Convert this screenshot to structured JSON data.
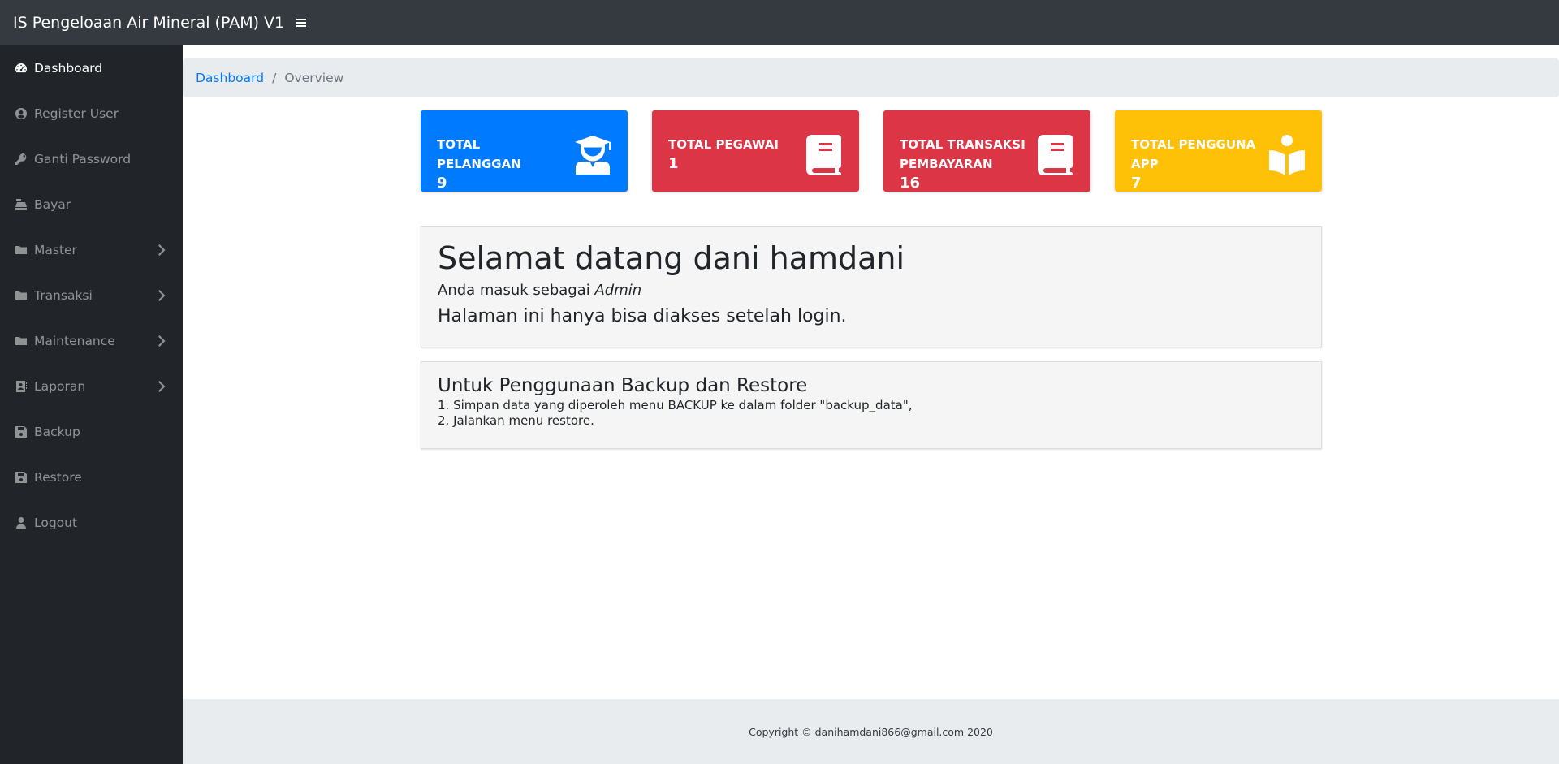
{
  "header": {
    "title": "IS Pengeloaan Air Mineral (PAM) V1",
    "menu_icon": "hamburger-icon"
  },
  "sidebar": {
    "items": [
      {
        "label": "Dashboard",
        "icon": "tachometer-icon",
        "active": true,
        "has_arrow": false
      },
      {
        "label": "Register User",
        "icon": "user-circle-icon",
        "active": false,
        "has_arrow": false
      },
      {
        "label": "Ganti Password",
        "icon": "key-icon",
        "active": false,
        "has_arrow": false
      },
      {
        "label": "Bayar",
        "icon": "cash-register-icon",
        "active": false,
        "has_arrow": false
      },
      {
        "label": "Master",
        "icon": "folder-icon",
        "active": false,
        "has_arrow": true
      },
      {
        "label": "Transaksi",
        "icon": "folder-icon",
        "active": false,
        "has_arrow": true
      },
      {
        "label": "Maintenance",
        "icon": "folder-icon",
        "active": false,
        "has_arrow": true
      },
      {
        "label": "Laporan",
        "icon": "address-book-icon",
        "active": false,
        "has_arrow": true
      },
      {
        "label": "Backup",
        "icon": "save-icon",
        "active": false,
        "has_arrow": false
      },
      {
        "label": "Restore",
        "icon": "save-icon",
        "active": false,
        "has_arrow": false
      },
      {
        "label": "Logout",
        "icon": "user-icon",
        "active": false,
        "has_arrow": false
      }
    ]
  },
  "breadcrumb": {
    "link": "Dashboard",
    "separator": "/",
    "current": "Overview"
  },
  "cards": [
    {
      "title": "TOTAL PELANGGAN",
      "value": "9",
      "icon": "user-graduate-icon",
      "color": "#007bff"
    },
    {
      "title": "TOTAL PEGAWAI",
      "value": "1",
      "icon": "book-icon",
      "color": "#dc3545"
    },
    {
      "title": "TOTAL TRANSAKSI PEMBAYARAN",
      "value": "16",
      "icon": "book-icon",
      "color": "#dc3545"
    },
    {
      "title": "TOTAL PENGGUNA APP",
      "value": "7",
      "icon": "book-reader-icon",
      "color": "#ffc107"
    }
  ],
  "welcome": {
    "heading": "Selamat datang dani hamdani",
    "role_prefix": "Anda masuk sebagai ",
    "role": "Admin",
    "note": "Halaman ini hanya bisa diakses setelah login."
  },
  "backup_info": {
    "heading": "Untuk Penggunaan Backup dan Restore",
    "step1": "1. Simpan data yang diperoleh menu BACKUP ke dalam folder \"backup_data\",",
    "step2": "2. Jalankan menu restore."
  },
  "footer": {
    "text": "Copyright © danihamdani866@gmail.com 2020"
  }
}
